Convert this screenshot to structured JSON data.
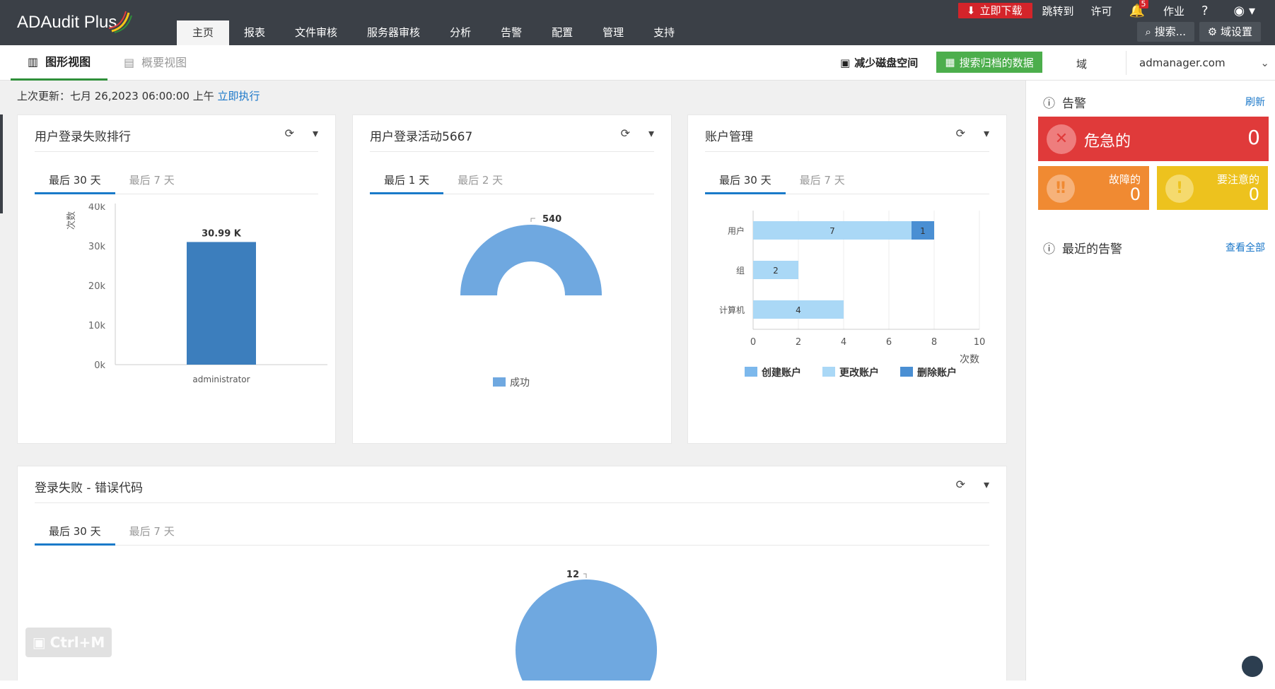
{
  "app": {
    "logo_text": "ADAudit Plus"
  },
  "nav": {
    "items": [
      "主页",
      "报表",
      "文件审核",
      "服务器审核",
      "分析",
      "告警",
      "配置",
      "管理",
      "支持"
    ],
    "active": "主页"
  },
  "topbar": {
    "download_label": "立即下载",
    "jump_label": "跳转到",
    "license_label": "许可",
    "notification_count": "5",
    "jobs_label": "作业",
    "help_label": "?",
    "search_label": "搜索...",
    "domain_settings_label": "域设置"
  },
  "subbar": {
    "graph_view_label": "图形视图",
    "summary_view_label": "概要视图",
    "reduce_disk_label": "减少磁盘空间",
    "search_archive_label": "搜索归档的数据",
    "domain_label": "域",
    "domain_value": "admanager.com"
  },
  "last_update": {
    "label": "上次更新：七月 26,2023 06:00:00 上午",
    "action": "立即执行"
  },
  "widgets": {
    "login_failures": {
      "title": "用户登录失败排行",
      "tabs": [
        "最后 30 天",
        "最后 7 天"
      ],
      "active_tab": "最后 30 天"
    },
    "login_activity": {
      "title": "用户登录活动5667",
      "tabs": [
        "最后 1 天",
        "最后 2 天"
      ],
      "active_tab": "最后 1 天"
    },
    "account_mgmt": {
      "title": "账户管理",
      "tabs": [
        "最后 30 天",
        "最后 7 天"
      ],
      "active_tab": "最后 30 天"
    },
    "error_codes": {
      "title": "登录失败 - 错误代码",
      "tabs": [
        "最后 30 天",
        "最后 7 天"
      ],
      "active_tab": "最后 30 天"
    }
  },
  "chart_data": [
    {
      "type": "bar",
      "categories": [
        "administrator"
      ],
      "values": [
        30990
      ],
      "data_labels": [
        "30.99 K"
      ],
      "ylabel": "次数",
      "ylim": [
        0,
        40000
      ],
      "yticks": [
        "0k",
        "10k",
        "20k",
        "30k",
        "40k"
      ],
      "color": "#3c7ebd"
    },
    {
      "type": "pie",
      "variant": "semi-donut",
      "categories": [
        "成功"
      ],
      "values": [
        540
      ],
      "data_labels": [
        "540"
      ],
      "legend": [
        "成功"
      ],
      "color": "#6fa8e0"
    },
    {
      "type": "bar",
      "orientation": "horizontal",
      "stacked": true,
      "categories": [
        "用户",
        "组",
        "计算机"
      ],
      "series": [
        {
          "name": "创建账户",
          "values": [
            0,
            0,
            0
          ],
          "color": "#7cb8ec"
        },
        {
          "name": "更改账户",
          "values": [
            7,
            2,
            4
          ],
          "color": "#aad8f6"
        },
        {
          "name": "删除账户",
          "values": [
            1,
            0,
            0
          ],
          "color": "#4a8fd3"
        }
      ],
      "xlabel": "次数",
      "xlim": [
        0,
        10
      ],
      "xticks": [
        "0",
        "2",
        "4",
        "6",
        "8",
        "10"
      ],
      "legend": [
        "创建账户",
        "更改账户",
        "删除账户"
      ]
    },
    {
      "type": "pie",
      "categories": [
        ""
      ],
      "values": [
        12
      ],
      "data_labels": [
        "12"
      ],
      "color": "#6fa8e0"
    }
  ],
  "alerts": {
    "title": "告警",
    "refresh_label": "刷新",
    "critical_label": "危急的",
    "critical_count": "0",
    "fault_label": "故障的",
    "fault_count": "0",
    "warning_label": "要注意的",
    "warning_count": "0",
    "recent_title": "最近的告警",
    "view_all_label": "查看全部"
  },
  "overlay": {
    "shortcut_label": "Ctrl+M"
  }
}
